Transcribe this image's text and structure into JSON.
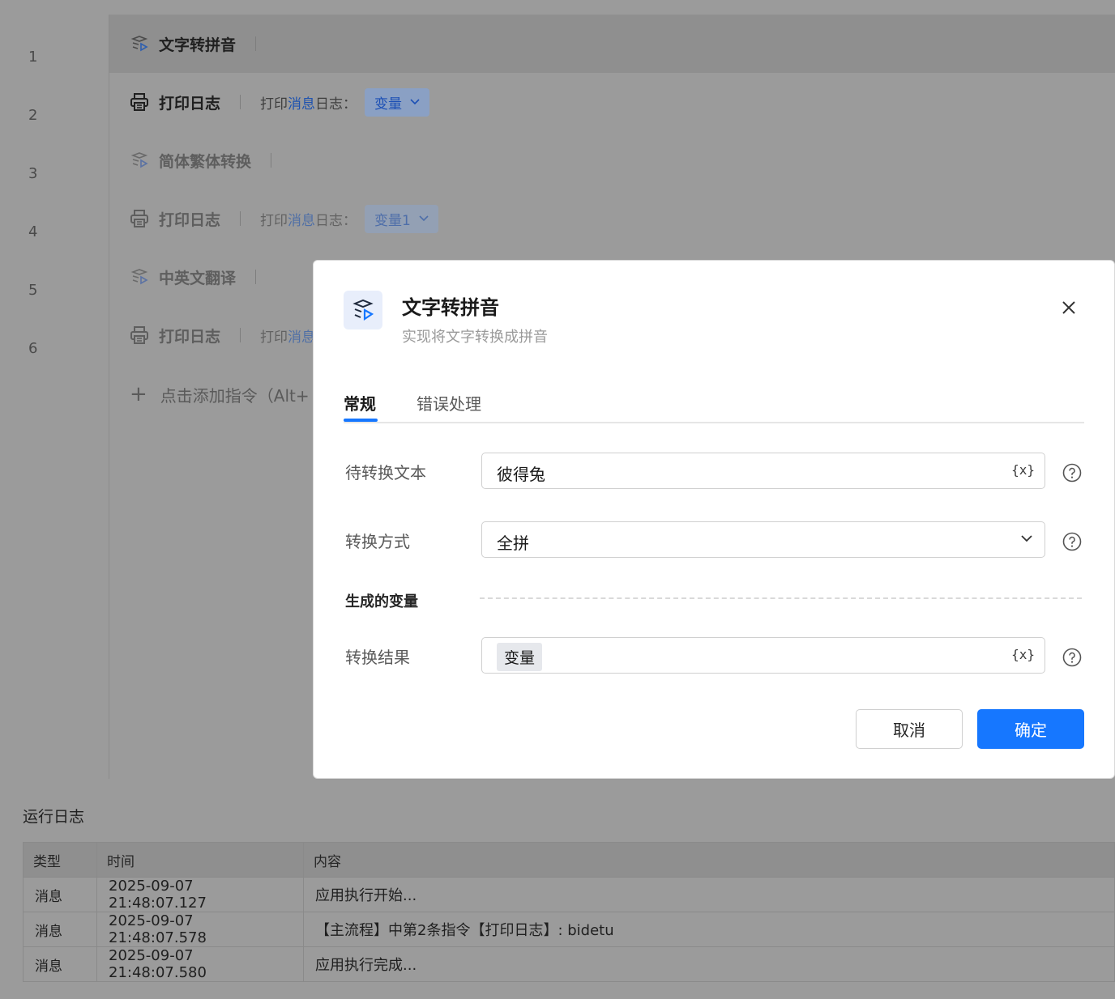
{
  "editor": {
    "line_numbers": [
      "1",
      "2",
      "3",
      "4",
      "5",
      "6"
    ],
    "commands": [
      {
        "title": "文字转拼音"
      },
      {
        "title": "打印日志",
        "param_prefix": "打印",
        "param_kw": "消息",
        "param_suffix": "日志：",
        "var": "变量"
      },
      {
        "title": "简体繁体转换"
      },
      {
        "title": "打印日志",
        "param_prefix": "打印",
        "param_kw": "消息",
        "param_suffix": "日志：",
        "var": "变量1"
      },
      {
        "title": "中英文翻译"
      },
      {
        "title": "打印日志",
        "param_prefix": "打印",
        "param_kw": "消息"
      }
    ],
    "add_command": "点击添加指令（Alt+"
  },
  "log": {
    "title": "运行日志",
    "columns": [
      "类型",
      "时间",
      "内容"
    ],
    "rows": [
      {
        "type": "消息",
        "time": "2025-09-07 21:48:07.127",
        "content": "应用执行开始..."
      },
      {
        "type": "消息",
        "time": "2025-09-07 21:48:07.578",
        "content": "【主流程】中第2条指令【打印日志】: bidetu"
      },
      {
        "type": "消息",
        "time": "2025-09-07 21:48:07.580",
        "content": "应用执行完成..."
      }
    ]
  },
  "dialog": {
    "title": "文字转拼音",
    "subtitle": "实现将文字转换成拼音",
    "tabs": [
      "常规",
      "错误处理"
    ],
    "fields": {
      "source_text": {
        "label": "待转换文本",
        "value": "彼得兔",
        "var_button": "{x}"
      },
      "method": {
        "label": "转换方式",
        "value": "全拼"
      },
      "section": "生成的变量",
      "result": {
        "label": "转换结果",
        "value": "变量",
        "var_button": "{x}"
      }
    },
    "buttons": {
      "cancel": "取消",
      "ok": "确定"
    },
    "accent_color": "#1677ff"
  }
}
